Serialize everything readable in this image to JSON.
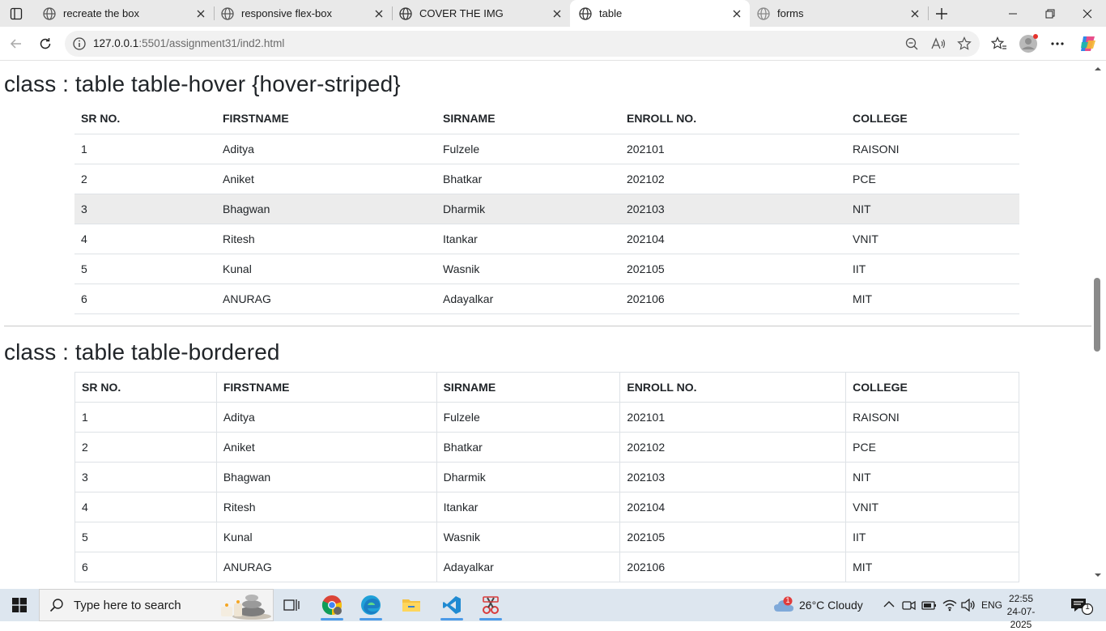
{
  "browser": {
    "tabs": [
      {
        "title": "recreate the box",
        "active": false
      },
      {
        "title": "responsive flex-box",
        "active": false
      },
      {
        "title": "COVER THE IMG",
        "active": false
      },
      {
        "title": "table",
        "active": true
      },
      {
        "title": "forms",
        "active": false
      }
    ],
    "url_host": "127.0.0.1",
    "url_rest": ":5501/assignment31/ind2.html"
  },
  "page": {
    "section1_title": "class : table table-hover {hover-striped}",
    "section2_title": "class : table table-bordered",
    "headers": [
      "SR NO.",
      "FIRSTNAME",
      "SIRNAME",
      "ENROLL NO.",
      "COLLEGE"
    ],
    "rows": [
      [
        "1",
        "Aditya",
        "Fulzele",
        "202101",
        "RAISONI"
      ],
      [
        "2",
        "Aniket",
        "Bhatkar",
        "202102",
        "PCE"
      ],
      [
        "3",
        "Bhagwan",
        "Dharmik",
        "202103",
        "NIT"
      ],
      [
        "4",
        "Ritesh",
        "Itankar",
        "202104",
        "VNIT"
      ],
      [
        "5",
        "Kunal",
        "Wasnik",
        "202105",
        "IIT"
      ],
      [
        "6",
        "ANURAG",
        "Adayalkar",
        "202106",
        "MIT"
      ]
    ],
    "hovered_row_index": 2
  },
  "taskbar": {
    "search_placeholder": "Type here to search",
    "weather": "26°C  Cloudy",
    "weather_badge": "1",
    "language": "ENG",
    "time": "22:55",
    "date": "24-07-2025",
    "notification_count": "1"
  },
  "colors": {
    "accent": "#0078d4",
    "hover_row": "#ececec",
    "border": "#dee2e6",
    "taskbar": "#dde6ef"
  }
}
